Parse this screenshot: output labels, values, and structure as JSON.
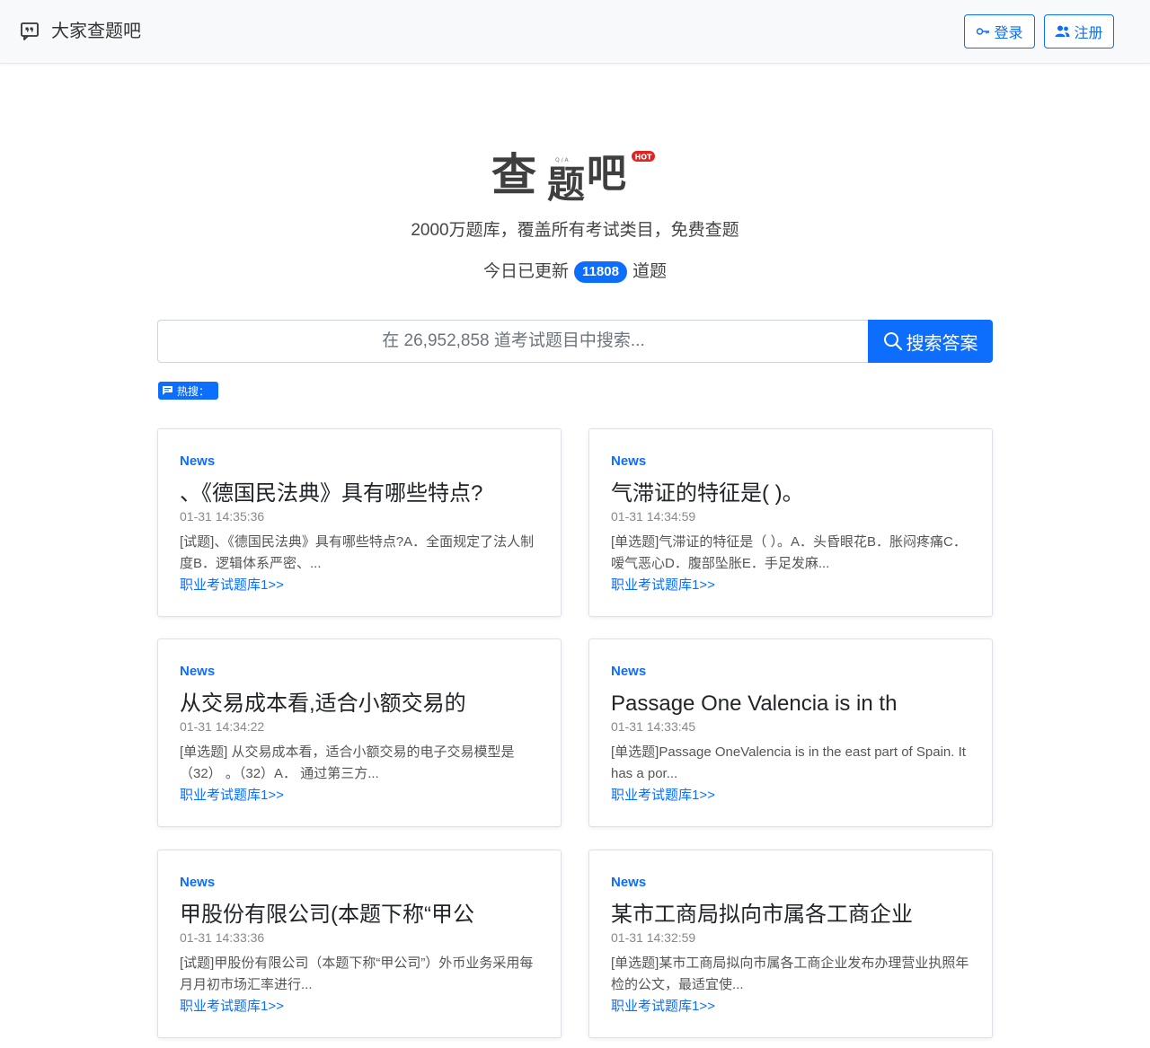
{
  "header": {
    "brand_icon": "chat-quote-icon",
    "brand": "大家查题吧",
    "login_label": "登录",
    "register_label": "注册"
  },
  "hero": {
    "logo_text": [
      "查",
      "题",
      "吧"
    ],
    "logo_qa": "Q / A",
    "logo_badge": "HOT",
    "tagline": "2000万题库，覆盖所有考试类目，免费查题",
    "updated_prefix": "今日已更新",
    "updated_count": "11808",
    "updated_suffix": "道题"
  },
  "search": {
    "placeholder": "在 26,952,858 道考试题目中搜索...",
    "button_label": "搜索答案",
    "hot_label": "热搜："
  },
  "cards": [
    {
      "category": "News",
      "title": "、《德国民法典》具有哪些特点?",
      "time": "01-31 14:35:36",
      "excerpt": "[试题]、《德国民法典》具有哪些特点?A．全面规定了法人制度B．逻辑体系严密、...",
      "link": "职业考试题库1>>"
    },
    {
      "category": "News",
      "title": "气滞证的特征是( )。",
      "time": "01-31 14:34:59",
      "excerpt": "[单选题]气滞证的特征是（ ）。A．头昏眼花B．胀闷疼痛C．嗳气恶心D．腹部坠胀E．手足发麻...",
      "link": "职业考试题库1>>"
    },
    {
      "category": "News",
      "title": "从交易成本看,适合小额交易的",
      "time": "01-31 14:34:22",
      "excerpt": "[单选题] 从交易成本看，适合小额交易的电子交易模型是（32） 。（32）A． 通过第三方...",
      "link": "职业考试题库1>>"
    },
    {
      "category": "News",
      "title": "Passage One Valencia is in th",
      "time": "01-31 14:33:45",
      "excerpt": "[单选题]Passage OneValencia is in the east part of Spain. It has a por...",
      "link": "职业考试题库1>>"
    },
    {
      "category": "News",
      "title": "甲股份有限公司(本题下称“甲公",
      "time": "01-31 14:33:36",
      "excerpt": "[试题]甲股份有限公司（本题下称“甲公司”）外币业务采用每月月初市场汇率进行...",
      "link": "职业考试题库1>>"
    },
    {
      "category": "News",
      "title": "某市工商局拟向市属各工商企业",
      "time": "01-31 14:32:59",
      "excerpt": "[单选题]某市工商局拟向市属各工商企业发布办理营业执照年检的公文，最适宜使...",
      "link": "职业考试题库1>>"
    }
  ]
}
